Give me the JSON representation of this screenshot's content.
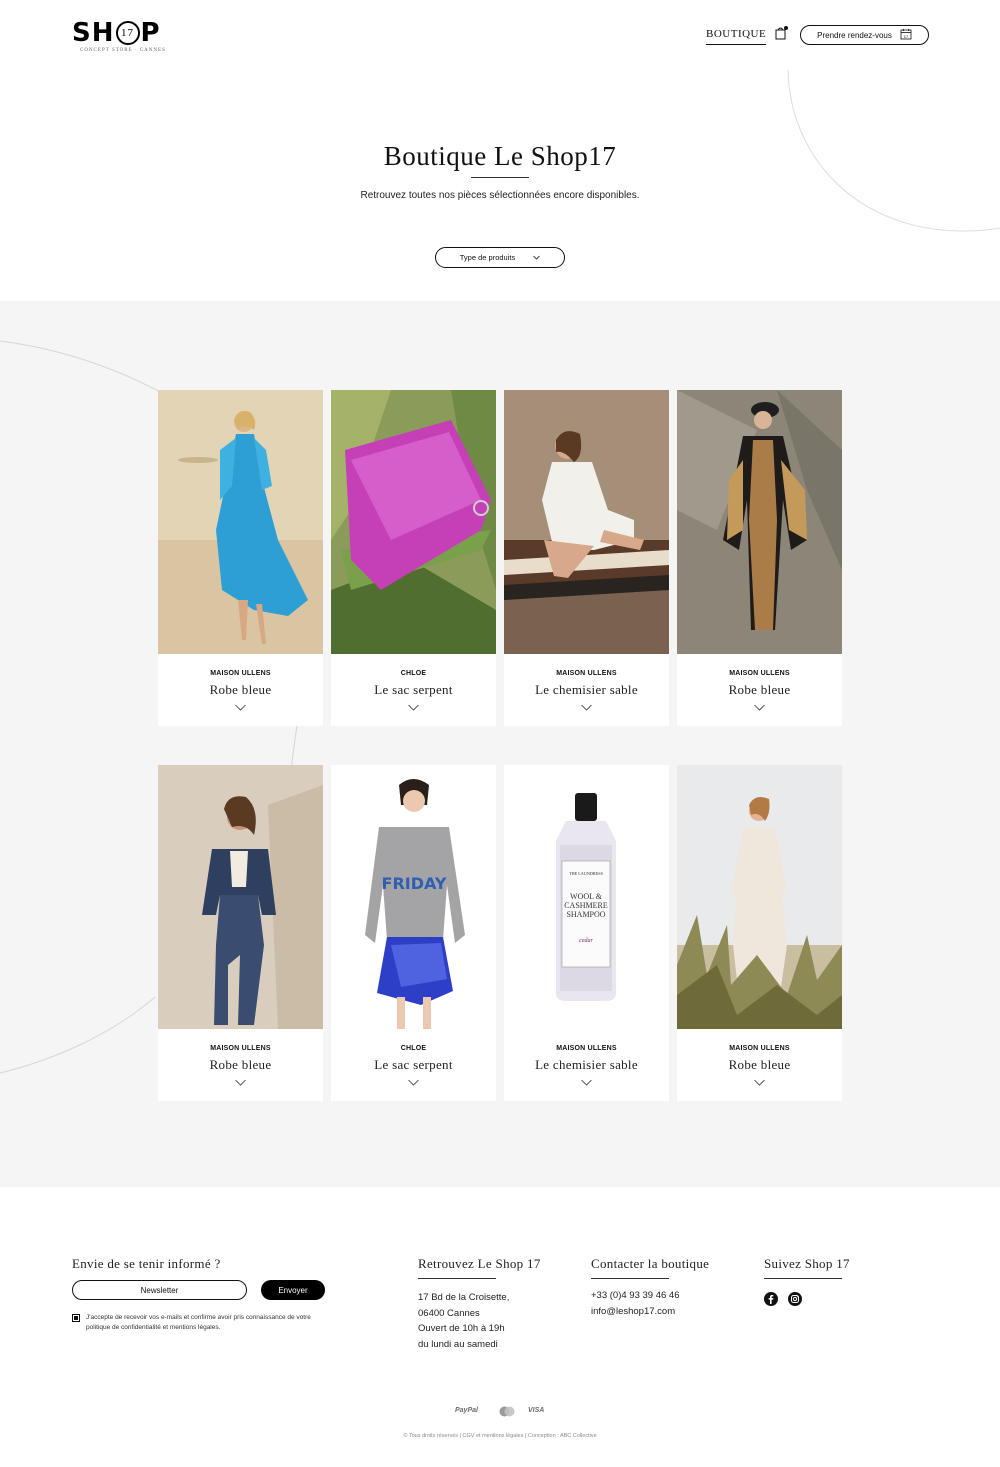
{
  "header": {
    "logo": {
      "word_left": "SH",
      "circle": "17",
      "word_right": "P",
      "subtitle": "CONCEPT STORE · CANNES"
    },
    "nav_boutique": "BOUTIQUE",
    "cart_count": "0",
    "appointment_label": "Prendre rendez-vous",
    "calendar_day": "17"
  },
  "hero": {
    "title": "Boutique Le Shop17",
    "subtitle": "Retrouvez toutes nos pièces sélectionnées encore disponibles.",
    "filter_label": "Type de produits"
  },
  "products": [
    {
      "brand": "MAISON ULLENS",
      "name": "Robe bleue",
      "image": "model-in-blue-lace-dress-on-beach"
    },
    {
      "brand": "CHLOE",
      "name": "Le sac serpent",
      "image": "pink-snakeskin-bag-in-aloe-plant"
    },
    {
      "brand": "MAISON ULLENS",
      "name": "Le chemisier sable",
      "image": "model-in-white-shirt-seated-on-rug"
    },
    {
      "brand": "MAISON ULLENS",
      "name": "Robe bleue",
      "image": "model-in-leopard-kimono-and-beret"
    },
    {
      "brand": "MAISON ULLENS",
      "name": "Robe bleue",
      "image": "model-in-denim-jacket-and-jeans"
    },
    {
      "brand": "CHLOE",
      "name": "Le sac serpent",
      "image": "model-in-grey-friday-sweater-and-blue-sequin-skirt"
    },
    {
      "brand": "MAISON ULLENS",
      "name": "Le chemisier sable",
      "image": "laundress-shampoo-bottle"
    },
    {
      "brand": "MAISON ULLENS",
      "name": "Robe bleue",
      "image": "model-in-white-lace-dress-in-dunes"
    }
  ],
  "product_texts": {
    "sweater_word": "FRIDAY",
    "bottle_brand": "THE LAUNDRESS",
    "bottle_lines": [
      "WOOL &",
      "CASHMERE",
      "SHAMPOO"
    ],
    "bottle_scent": "cedar"
  },
  "footer": {
    "newsletter_title": "Envie de se tenir informé ?",
    "newsletter_placeholder": "Newsletter",
    "send_label": "Envoyer",
    "consent": "J'accepte de recevoir vos e-mails et confirme avoir pris connaissance de votre politique de confidentialité et mentions légales.",
    "find_title": "Retrouvez Le Shop 17",
    "address": [
      "17 Bd de la Croisette,",
      "06400 Cannes",
      "Ouvert de 10h à 19h",
      "du lundi au samedi"
    ],
    "contact_title": "Contacter la boutique",
    "contact": [
      "+33 (0)4 93 39 46 46",
      "info@leshop17.com"
    ],
    "follow_title": "Suivez Shop 17",
    "social_icons": [
      "facebook-icon",
      "instagram-icon"
    ],
    "payments": [
      "PayPal",
      "mastercard",
      "VISA"
    ],
    "copyright": "© Tous droits réservés | CGV et mentions légales | Conception : ABC Collective"
  }
}
